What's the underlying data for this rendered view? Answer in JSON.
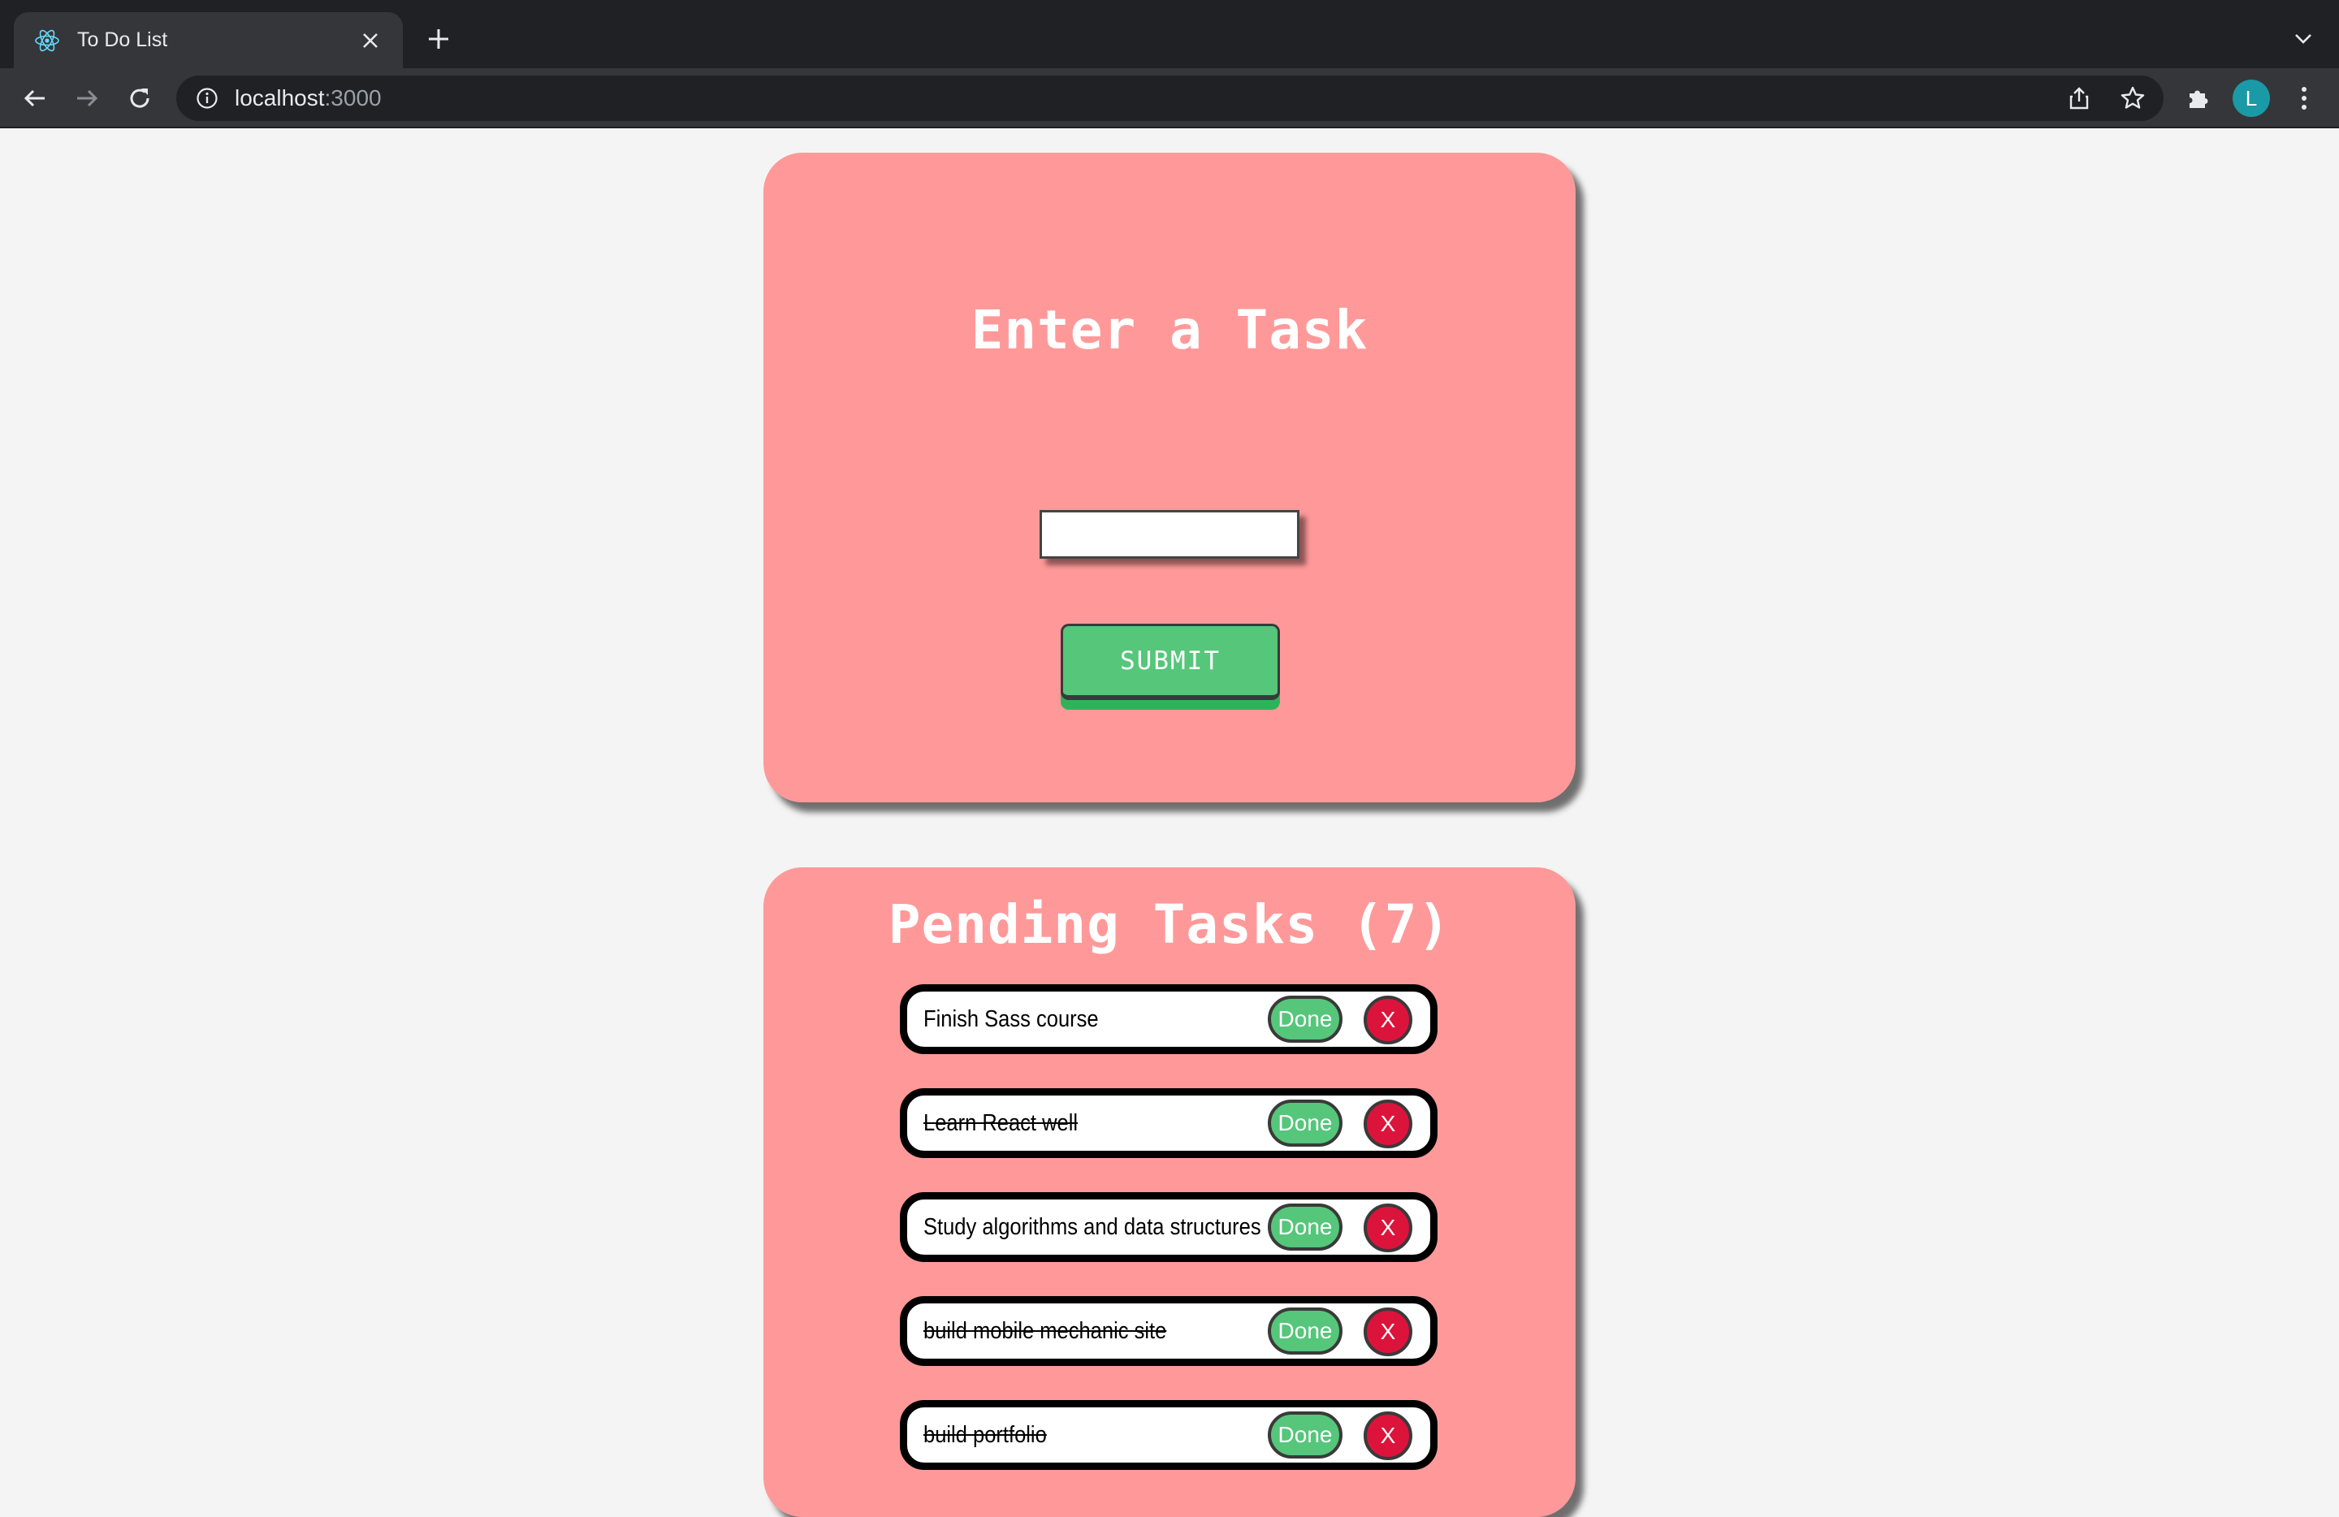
{
  "browser": {
    "tab_title": "To Do List",
    "url_host": "localhost",
    "url_port": ":3000",
    "avatar_initial": "L"
  },
  "input_card": {
    "heading": "Enter a Task",
    "input_value": "",
    "submit_label": "SUBMIT"
  },
  "list_card": {
    "heading": "Pending Tasks (7)",
    "done_label": "Done",
    "delete_label": "X",
    "tasks": [
      {
        "text": "Finish Sass course",
        "completed": false
      },
      {
        "text": "Learn React well",
        "completed": true
      },
      {
        "text": "Study algorithms and data structures",
        "completed": false
      },
      {
        "text": "build mobile mechanic site",
        "completed": true
      },
      {
        "text": "build portfolio",
        "completed": true
      }
    ]
  },
  "colors": {
    "card": "#ff9999",
    "done_button": "#55c67a",
    "delete_button": "#dc143c",
    "page_background": "#f4f4f4"
  }
}
